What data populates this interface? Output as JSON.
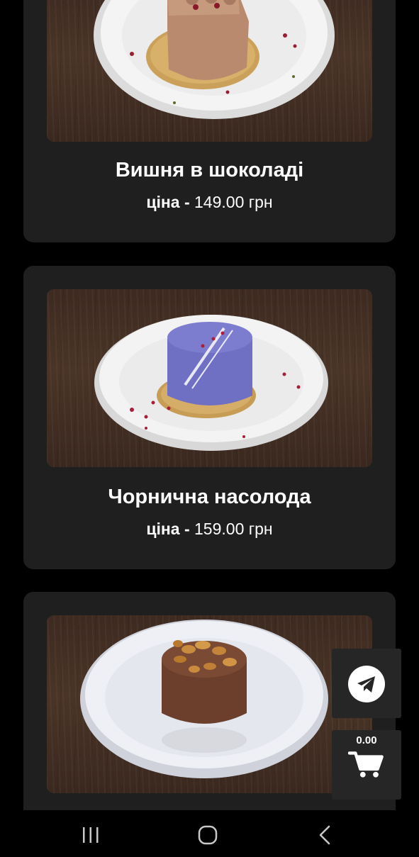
{
  "products": [
    {
      "name": "Вишня в шоколаді",
      "price_label": "ціна - ",
      "price_value": "149.00 грн",
      "dessert_color": "#b98a6d"
    },
    {
      "name": "Чорнична насолода",
      "price_label": "ціна - ",
      "price_value": "159.00 грн",
      "dessert_color": "#6f6fc4"
    },
    {
      "name": "",
      "price_label": "",
      "price_value": "",
      "dessert_color": "#6b3f2c"
    }
  ],
  "floating": {
    "telegram_icon": "telegram-icon",
    "cart_icon": "shopping-cart-icon",
    "cart_total": "0.00"
  },
  "system_nav": {
    "recent_icon": "recent-apps-icon",
    "home_icon": "home-icon",
    "back_icon": "back-icon"
  },
  "colors": {
    "background": "#000000",
    "card": "#1f1f1f",
    "float_button": "#262626"
  }
}
